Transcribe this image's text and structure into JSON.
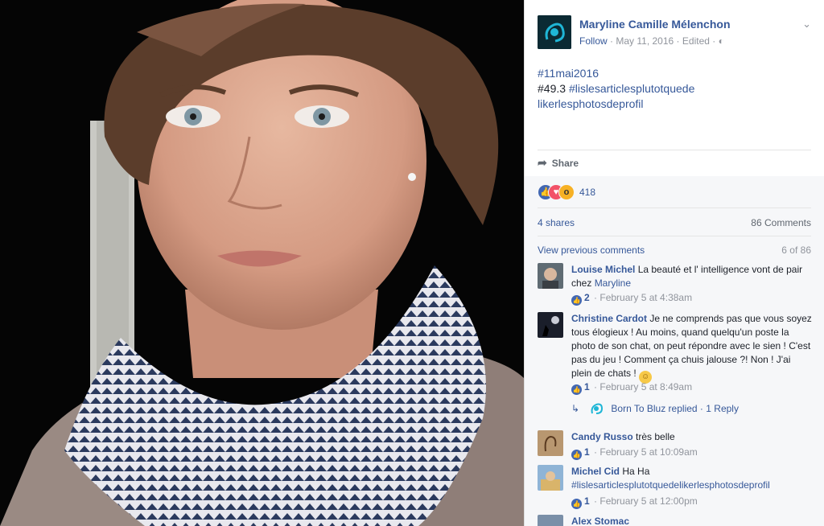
{
  "post": {
    "page_name": "Maryline Camille Mélenchon",
    "follow": "Follow",
    "date": "May 11, 2016",
    "edited": "Edited",
    "sep": "·",
    "hashtag1": "#11mai2016",
    "text_prefix": "#49.3 ",
    "hashtag2": "#lislesarticlesplutotquede",
    "hashtag2_line2": "likerlesphotosdeprofil",
    "share_label": "Share",
    "reaction_count": "418",
    "shares": "4 shares",
    "comments_count": "86 Comments",
    "view_previous": "View previous comments",
    "of_count": "6 of 86"
  },
  "comments": [
    {
      "author": "Louise Michel",
      "text": "La beauté et l' intelligence vont de pair chez ",
      "link": "Maryline",
      "likes": "2",
      "time": "February 5 at 4:38am"
    },
    {
      "author": "Christine Cardot",
      "text": "Je ne comprends pas que vous soyez tous élogieux ! Au moins, quand quelqu'un poste la photo de son chat, on peut répondre avec le sien ! C'est pas du jeu ! Comment ça chuis jalouse ?! Non ! J'ai plein de chats !",
      "likes": "1",
      "time": "February 5 at 8:49am",
      "reply_text": "Born To Bluz replied",
      "reply_count": "1 Reply"
    },
    {
      "author": "Candy Russo",
      "text": "très belle",
      "likes": "1",
      "time": "February 5 at 10:09am"
    },
    {
      "author": "Michel Cid",
      "text": "Ha Ha",
      "link": "#lislesarticlesplutotquedelikerlesphotosdeprofil",
      "likes": "1",
      "time": "February 5 at 12:00pm"
    },
    {
      "author": "Alex Stomac"
    }
  ]
}
